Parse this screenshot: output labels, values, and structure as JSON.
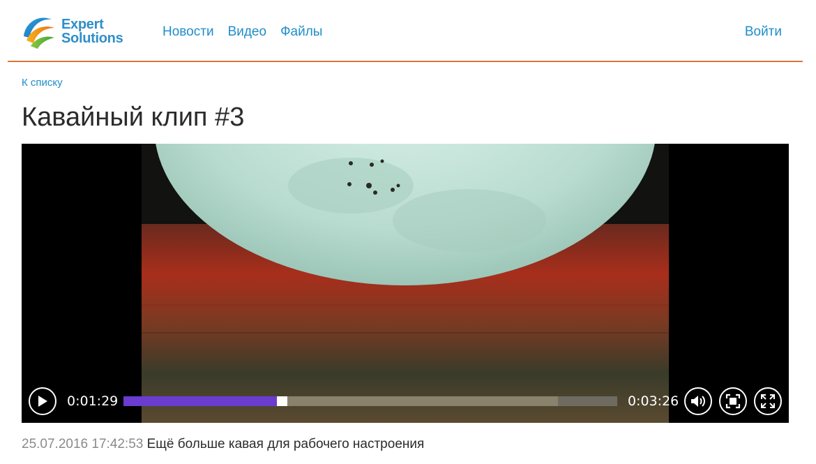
{
  "header": {
    "logo_line1": "Expert",
    "logo_line2": "Solutions",
    "nav": [
      "Новости",
      "Видео",
      "Файлы"
    ],
    "login": "Войти"
  },
  "back_link": "К списку",
  "title": "Кавайный клип #3",
  "player": {
    "current_time": "0:01:29",
    "duration": "0:03:26",
    "progress": 0.32,
    "buffered": 0.88
  },
  "meta": {
    "date": "25.07.2016 17:42:53",
    "description": "Ещё больше кавая для рабочего настроения"
  },
  "colors": {
    "link": "#1f8dc9",
    "divider": "#de7636",
    "progress": "#6b3cd0"
  }
}
